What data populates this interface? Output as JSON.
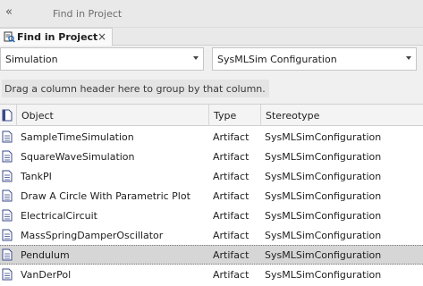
{
  "window": {
    "title": "Find in Project",
    "collapse_icon": "double-chevron-left-icon"
  },
  "tab": {
    "label": "Find in Project",
    "icon": "search-document-icon",
    "close_label": "×"
  },
  "search": {
    "scope_value": "Simulation",
    "search_value": "SysMLSim Configuration"
  },
  "group_hint": "Drag a column header here to group by that column.",
  "columns": {
    "icon": "document-icon",
    "object": "Object",
    "type": "Type",
    "stereotype": "Stereotype"
  },
  "rows": [
    {
      "name": "SampleTimeSimulation",
      "type": "Artifact",
      "stereotype": "SysMLSimConfiguration",
      "selected": false
    },
    {
      "name": "SquareWaveSimulation",
      "type": "Artifact",
      "stereotype": "SysMLSimConfiguration",
      "selected": false
    },
    {
      "name": "TankPI",
      "type": "Artifact",
      "stereotype": "SysMLSimConfiguration",
      "selected": false
    },
    {
      "name": "Draw A Circle With Parametric Plot",
      "type": "Artifact",
      "stereotype": "SysMLSimConfiguration",
      "selected": false
    },
    {
      "name": "ElectricalCircuit",
      "type": "Artifact",
      "stereotype": "SysMLSimConfiguration",
      "selected": false
    },
    {
      "name": "MassSpringDamperOscillator",
      "type": "Artifact",
      "stereotype": "SysMLSimConfiguration",
      "selected": false
    },
    {
      "name": "Pendulum",
      "type": "Artifact",
      "stereotype": "SysMLSimConfiguration",
      "selected": true
    },
    {
      "name": "VanDerPol",
      "type": "Artifact",
      "stereotype": "SysMLSimConfiguration",
      "selected": false
    }
  ]
}
